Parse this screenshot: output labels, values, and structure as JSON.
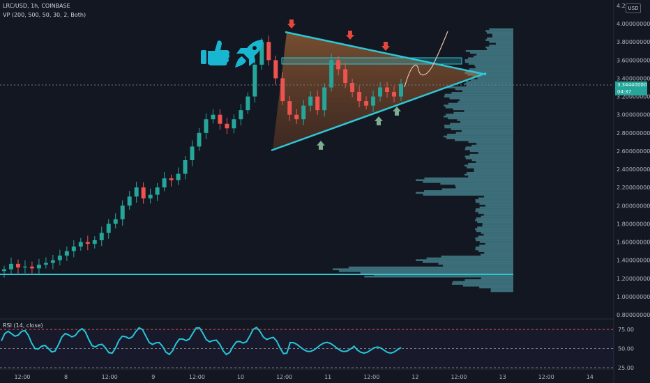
{
  "header": {
    "symbol_line": "LRC/USD, 1h, COINBASE",
    "indicator_line": "VP (200, 500, 50, 30, 2, Both)"
  },
  "rsi": {
    "title": "RSI (14, close)",
    "levels": [
      "75.00",
      "50.00",
      "25.00"
    ]
  },
  "price_axis": {
    "currency": "USD",
    "ticks": [
      "4.2",
      "4.00000000",
      "3.80000000",
      "3.60000000",
      "3.40000000",
      "3.20000000",
      "3.00000000",
      "2.80000000",
      "2.60000000",
      "2.40000000",
      "2.20000000",
      "2.00000000",
      "1.80000000",
      "1.60000000",
      "1.40000000",
      "1.20000000",
      "1.00000000",
      "0.80000000"
    ],
    "last_price": "3.34440000",
    "countdown": "04:37"
  },
  "time_axis": {
    "ticks": [
      "12:00",
      "8",
      "12:00",
      "9",
      "12:00",
      "10",
      "12:00",
      "11",
      "12:00",
      "12",
      "12:00",
      "13",
      "12:00",
      "14"
    ]
  },
  "colors": {
    "background": "#131722",
    "up": "#26a69a",
    "down": "#ef5350",
    "trendline": "#2ec7d6",
    "arrow_down": "#e2483c",
    "arrow_up": "#7cae8f",
    "profile": "#5fb8c2"
  },
  "icons": [
    "thumbs-up-icon",
    "rocket-icon"
  ],
  "chart_data": {
    "type": "candlestick",
    "title": "LRC/USD, 1h, COINBASE",
    "ylim": [
      0.8,
      4.2
    ],
    "x_ticks": [
      "12:00",
      "8",
      "12:00",
      "9",
      "12:00",
      "10",
      "12:00",
      "11",
      "12:00",
      "12",
      "12:00",
      "13",
      "12:00",
      "14"
    ],
    "close_approx": [
      1.3,
      1.36,
      1.32,
      1.33,
      1.31,
      1.35,
      1.37,
      1.4,
      1.45,
      1.5,
      1.55,
      1.6,
      1.58,
      1.62,
      1.7,
      1.8,
      1.85,
      2.0,
      2.1,
      2.2,
      2.08,
      2.12,
      2.2,
      2.3,
      2.28,
      2.35,
      2.5,
      2.65,
      2.8,
      2.95,
      3.0,
      2.9,
      2.85,
      2.95,
      3.05,
      3.2,
      3.55,
      3.8,
      3.6,
      3.4,
      3.15,
      3.0,
      2.95,
      3.1,
      3.2,
      3.05,
      3.3,
      3.6,
      3.5,
      3.35,
      3.25,
      3.15,
      3.1,
      3.2,
      3.3,
      3.25,
      3.2,
      3.34
    ],
    "last_price": 3.3444,
    "rsi_levels": [
      75,
      50,
      25
    ],
    "horizontal_support": 1.26,
    "resistance_zone": [
      3.57,
      3.63
    ]
  }
}
